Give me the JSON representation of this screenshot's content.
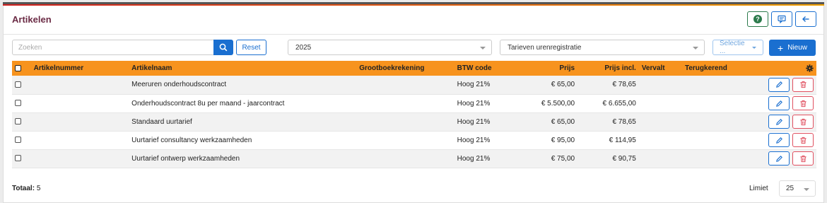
{
  "header": {
    "title": "Artikelen",
    "help_icon": "question-circle-icon",
    "chat_icon": "message-square-icon",
    "back_icon": "arrow-left-icon"
  },
  "toolbar": {
    "search_placeholder": "Zoeken",
    "search_icon": "search-icon",
    "reset_label": "Reset",
    "year_value": "2025",
    "tarief_value": "Tarieven urenregistratie",
    "selectie_label": "Selectie ...",
    "nieuw_label": "Nieuw"
  },
  "table": {
    "columns": [
      "Artikelnummer",
      "Artikelnaam",
      "Grootboekrekening",
      "BTW code",
      "Prijs",
      "Prijs incl.",
      "Vervalt",
      "Terugkerend"
    ],
    "settings_icon": "gear-icon",
    "rows": [
      {
        "artikelnummer": "",
        "artikelnaam": "Meeruren onderhoudscontract",
        "grootboekrekening": "",
        "btw": "Hoog 21%",
        "prijs": "€ 65,00",
        "prijs_incl": "€ 78,65",
        "vervalt": "",
        "terugkerend": ""
      },
      {
        "artikelnummer": "",
        "artikelnaam": "Onderhoudscontract 8u per maand - jaarcontract",
        "grootboekrekening": "",
        "btw": "Hoog 21%",
        "prijs": "€ 5.500,00",
        "prijs_incl": "€ 6.655,00",
        "vervalt": "",
        "terugkerend": ""
      },
      {
        "artikelnummer": "",
        "artikelnaam": "Standaard uurtarief",
        "grootboekrekening": "",
        "btw": "Hoog 21%",
        "prijs": "€ 65,00",
        "prijs_incl": "€ 78,65",
        "vervalt": "",
        "terugkerend": ""
      },
      {
        "artikelnummer": "",
        "artikelnaam": "Uurtarief consultancy werkzaamheden",
        "grootboekrekening": "",
        "btw": "Hoog 21%",
        "prijs": "€ 95,00",
        "prijs_incl": "€ 114,95",
        "vervalt": "",
        "terugkerend": ""
      },
      {
        "artikelnummer": "",
        "artikelnaam": "Uurtarief ontwerp werkzaamheden",
        "grootboekrekening": "",
        "btw": "Hoog 21%",
        "prijs": "€ 75,00",
        "prijs_incl": "€ 90,75",
        "vervalt": "",
        "terugkerend": ""
      }
    ]
  },
  "footer": {
    "totaal_label": "Totaal:",
    "totaal_value": "5",
    "limiet_label": "Limiet",
    "limiet_value": "25"
  },
  "colors": {
    "accent": "#1a6fd0",
    "header_row": "#f7931e",
    "title": "#6b2b45",
    "delete": "#e05060"
  }
}
